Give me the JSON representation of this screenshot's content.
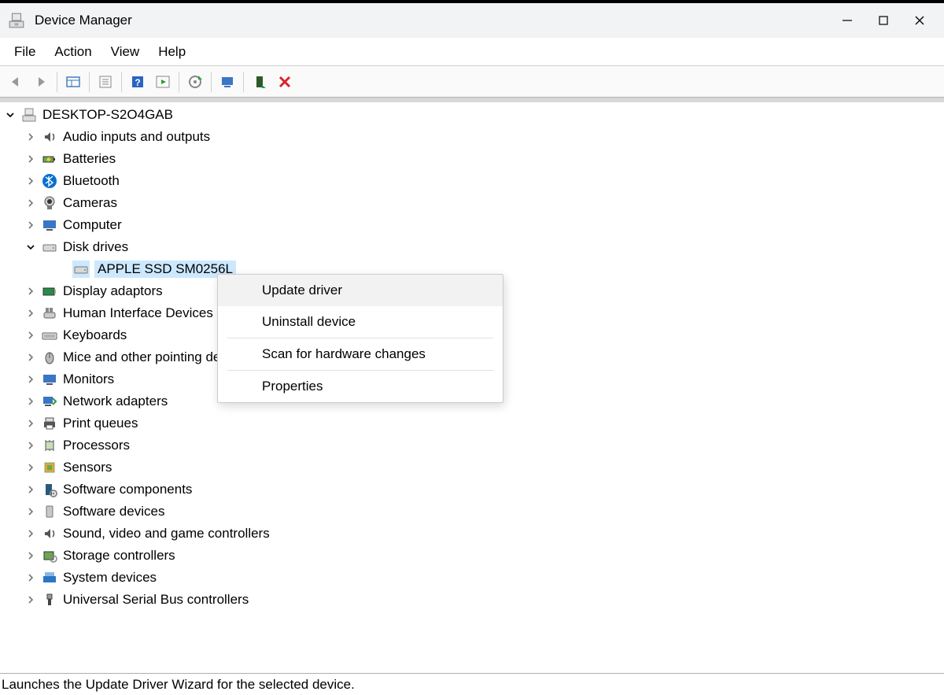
{
  "window": {
    "title": "Device Manager"
  },
  "menu": {
    "file": "File",
    "action": "Action",
    "view": "View",
    "help": "Help"
  },
  "tree": {
    "root": "DESKTOP-S2O4GAB",
    "categories": [
      {
        "label": "Audio inputs and outputs",
        "expanded": false
      },
      {
        "label": "Batteries",
        "expanded": false
      },
      {
        "label": "Bluetooth",
        "expanded": false
      },
      {
        "label": "Cameras",
        "expanded": false
      },
      {
        "label": "Computer",
        "expanded": false
      },
      {
        "label": "Disk drives",
        "expanded": true,
        "children": [
          {
            "label": "APPLE SSD SM0256L",
            "selected": true
          }
        ]
      },
      {
        "label": "Display adaptors",
        "expanded": false
      },
      {
        "label": "Human Interface Devices",
        "expanded": false
      },
      {
        "label": "Keyboards",
        "expanded": false
      },
      {
        "label": "Mice and other pointing devices",
        "expanded": false
      },
      {
        "label": "Monitors",
        "expanded": false
      },
      {
        "label": "Network adapters",
        "expanded": false
      },
      {
        "label": "Print queues",
        "expanded": false
      },
      {
        "label": "Processors",
        "expanded": false
      },
      {
        "label": "Sensors",
        "expanded": false
      },
      {
        "label": "Software components",
        "expanded": false
      },
      {
        "label": "Software devices",
        "expanded": false
      },
      {
        "label": "Sound, video and game controllers",
        "expanded": false
      },
      {
        "label": "Storage controllers",
        "expanded": false
      },
      {
        "label": "System devices",
        "expanded": false
      },
      {
        "label": "Universal Serial Bus controllers",
        "expanded": false
      }
    ]
  },
  "context_menu": {
    "items": [
      {
        "label": "Update driver",
        "hover": true
      },
      {
        "label": "Uninstall device"
      },
      {
        "sep": true
      },
      {
        "label": "Scan for hardware changes"
      },
      {
        "sep": true
      },
      {
        "label": "Properties"
      }
    ]
  },
  "statusbar": {
    "text": "Launches the Update Driver Wizard for the selected device."
  }
}
